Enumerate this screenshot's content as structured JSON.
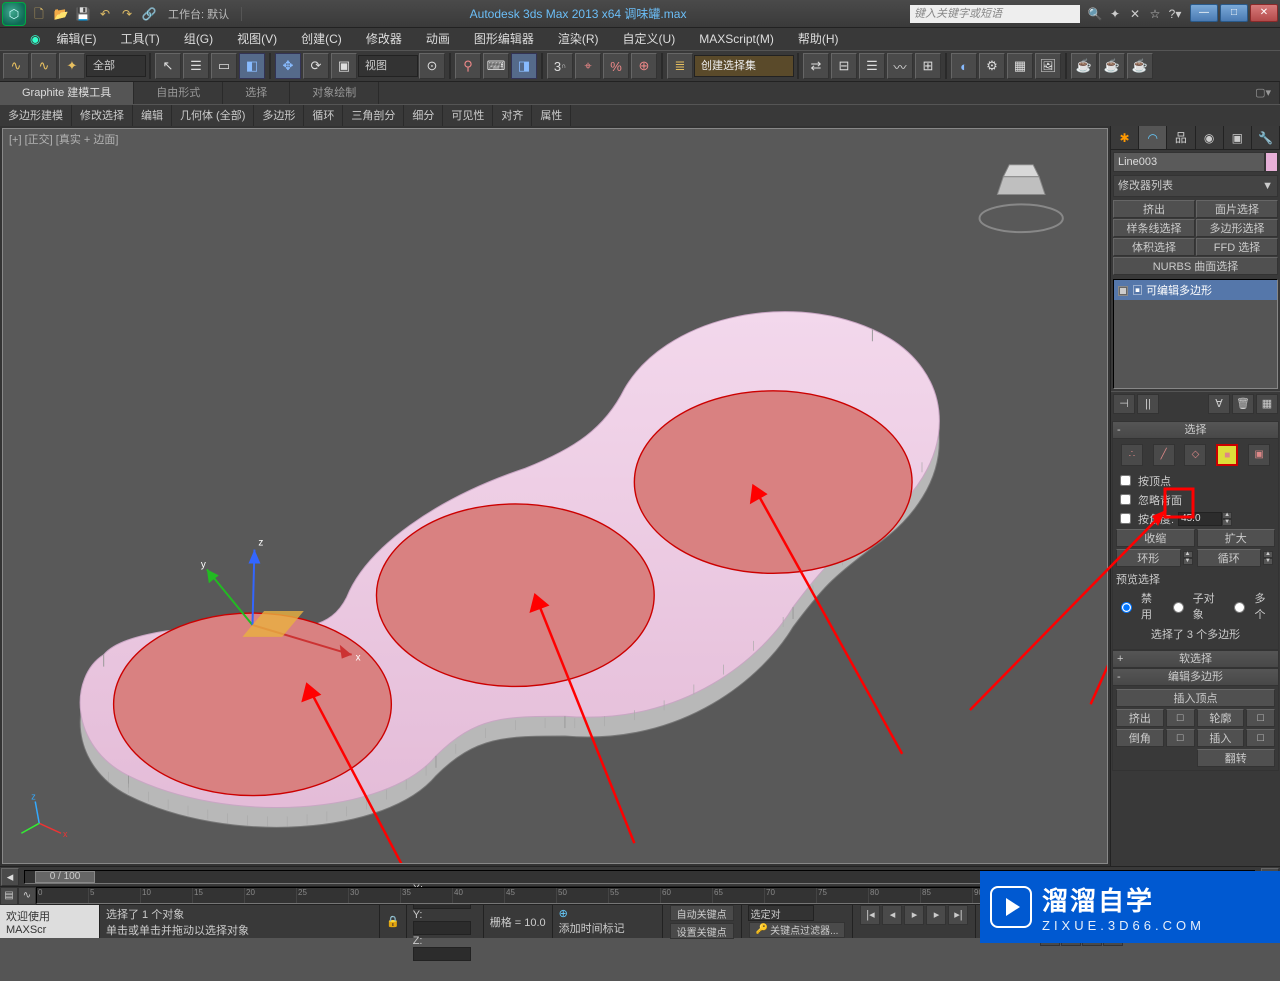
{
  "title": {
    "left": "工作台: 默认",
    "center": "Autodesk 3ds Max  2013 x64    调味罐.max",
    "search_placeholder": "键入关键字或短语"
  },
  "menus": [
    "编辑(E)",
    "工具(T)",
    "组(G)",
    "视图(V)",
    "创建(C)",
    "修改器",
    "动画",
    "图形编辑器",
    "渲染(R)",
    "自定义(U)",
    "MAXScript(M)",
    "帮助(H)"
  ],
  "main_toolbar": {
    "filter": "全部",
    "viewport_type": "视图",
    "named_set": "创建选择集"
  },
  "ribbon": {
    "tabs": [
      "Graphite 建模工具",
      "自由形式",
      "选择",
      "对象绘制"
    ],
    "groups": [
      "多边形建模",
      "修改选择",
      "编辑",
      "几何体 (全部)",
      "多边形",
      "循环",
      "三角剖分",
      "细分",
      "可见性",
      "对齐",
      "属性"
    ]
  },
  "viewport_label": "[+] [正交] [真实 + 边面]",
  "cmd": {
    "object_name": "Line003",
    "mod_dropdown": "修改器列表",
    "mod_buttons": [
      "挤出",
      "面片选择",
      "样条线选择",
      "多边形选择",
      "体积选择",
      "FFD 选择",
      "NURBS 曲面选择"
    ],
    "stack_item": "可编辑多边形",
    "rollouts": {
      "selection": {
        "title": "选择",
        "by_vertex": "按顶点",
        "ignore_back": "忽略背面",
        "by_angle": "按角度:",
        "angle": "45.0",
        "shrink": "收缩",
        "grow": "扩大",
        "ring": "环形",
        "loop": "循环",
        "preview": "预览选择",
        "off": "禁用",
        "subobj": "子对象",
        "multi": "多个",
        "info": "选择了 3 个多边形"
      },
      "soft": {
        "title": "软选择"
      },
      "editpoly": {
        "title": "编辑多边形",
        "insert_vertex": "插入顶点",
        "extrude": "挤出",
        "outline": "轮廓",
        "bevel": "倒角",
        "inset": "插入",
        "flip": "翻转"
      }
    }
  },
  "timeslider": {
    "value": "0 / 100"
  },
  "status": {
    "selected": "选择了 1 个对象",
    "prompt": "单击或单击并拖动以选择对象",
    "welcome": "欢迎使用  MAXScr",
    "x": "",
    "y": "",
    "z": "",
    "grid": "栅格 = 10.0",
    "add_time": "添加时间标记",
    "auto_key": "自动关键点",
    "set_key": "设置关键点",
    "sel_set": "选定对",
    "key_filter": "关键点过滤器..."
  },
  "watermark": {
    "big": "溜溜自学",
    "small": "ZIXUE.3D66.COM"
  }
}
